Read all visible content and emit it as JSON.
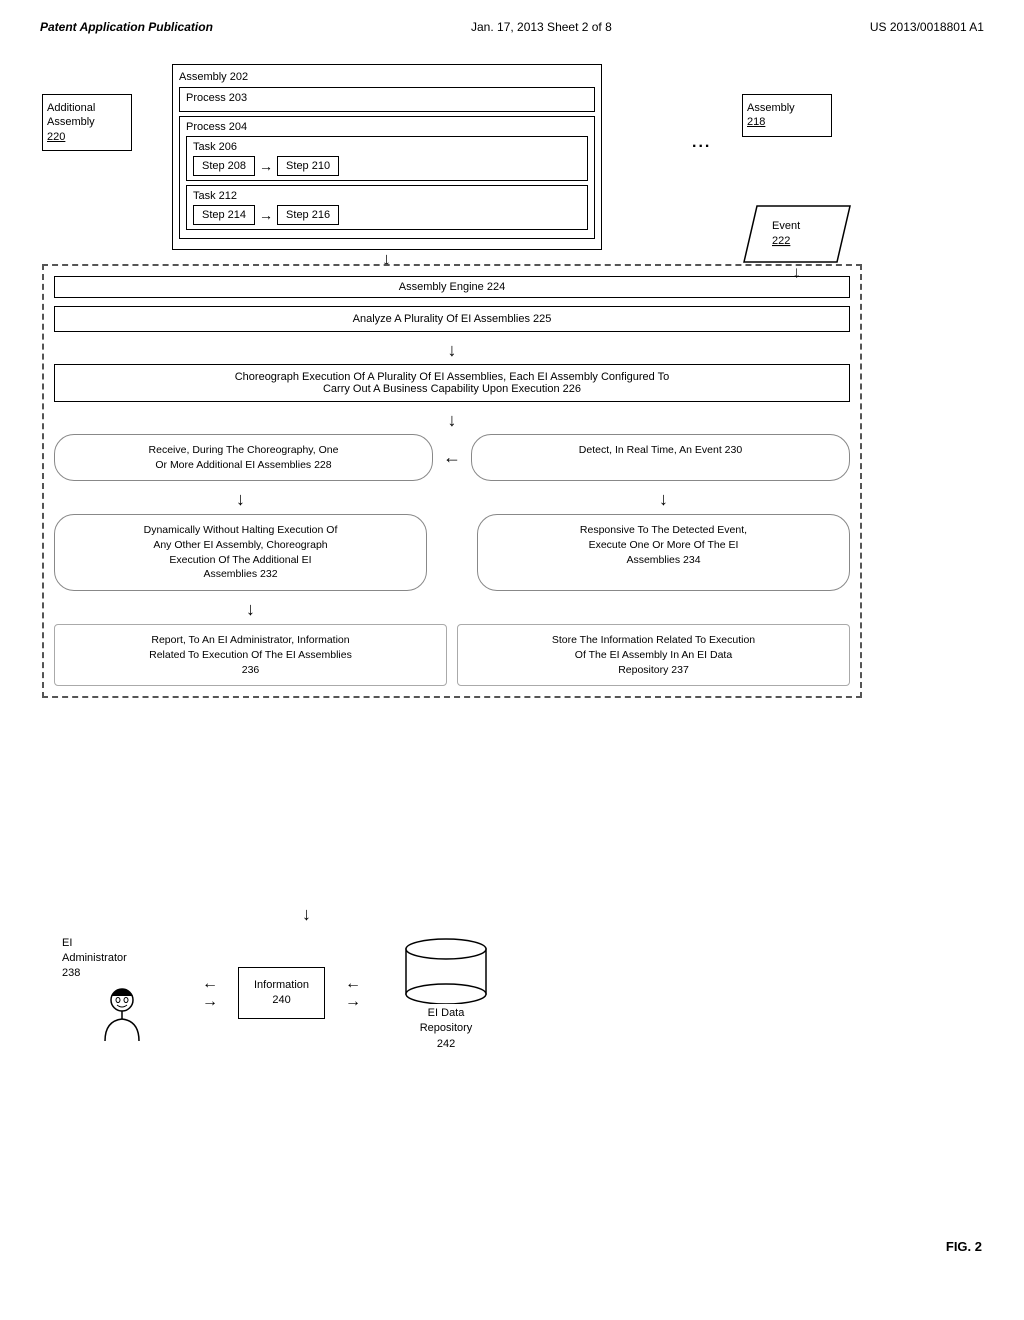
{
  "header": {
    "left": "Patent Application Publication",
    "center": "Jan. 17, 2013   Sheet 2 of 8",
    "right": "US 2013/0018801 A1"
  },
  "assembly202": {
    "label": "Assembly  202",
    "process203": {
      "label": "Process  203"
    },
    "process204": {
      "label": "Process  204",
      "task206": {
        "label": "Task  206",
        "step208": "Step  208",
        "step210": "Step  210"
      },
      "task212": {
        "label": "Task  212",
        "step214": "Step  214",
        "step216": "Step  216"
      }
    }
  },
  "additionalAssembly": {
    "label": "Additional\nAssembly\n220"
  },
  "assembly218": {
    "label": "Assembly\n218"
  },
  "ellipsis": "...",
  "event222": {
    "label": "Event\n222"
  },
  "engineBox": {
    "title": "Assembly Engine  224",
    "analyze": "Analyze A Plurality Of EI Assemblies  225",
    "choreograph": "Choreograph Execution Of A Plurality Of EI Assemblies, Each EI Assembly Configured To\nCarry Out A Business Capability Upon Execution  226",
    "receive": "Receive, During The Choreography, One\nOr More Additional EI Assemblies  228",
    "detect": "Detect, In Real Time, An Event  230",
    "dynamically": "Dynamically Without Halting Execution Of\nAny Other EI Assembly, Choreograph\nExecution Of The Additional EI\nAssemblies  232",
    "responsive": "Responsive To The Detected Event,\nExecute One Or More Of The EI\nAssemblies  234",
    "report": "Report, To An EI Administrator, Information\nRelated To Execution Of The EI Assemblies\n236",
    "store": "Store The Information Related To Execution\nOf The EI Assembly In An EI Data\nRepository  237"
  },
  "eiAdministrator": {
    "label": "EI\nAdministrator\n238"
  },
  "information": {
    "label": "Information\n240"
  },
  "eiDataRepository": {
    "label": "EI Data\nRepository\n242"
  },
  "figLabel": "FIG. 2"
}
